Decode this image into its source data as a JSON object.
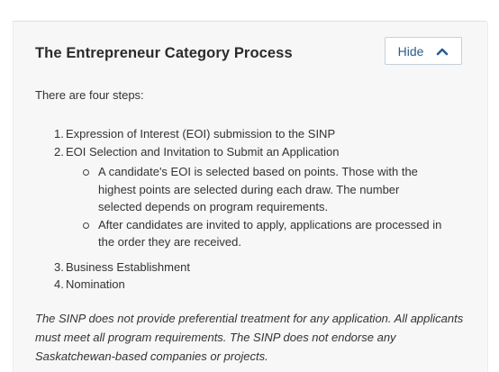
{
  "section": {
    "title": "The Entrepreneur Category Process",
    "toggle_label": "Hide",
    "intro": "There are four steps:",
    "steps": [
      {
        "number": "1.",
        "text": "Expression of Interest (EOI) submission to the SINP"
      },
      {
        "number": "2.",
        "text": "EOI Selection and Invitation to Submit an Application",
        "sub_items": [
          "A candidate's EOI is selected based on points. Those with the highest points are selected during each draw. The number selected depends on program requirements.",
          "After candidates are invited to apply, applications are processed in the order they are received."
        ]
      },
      {
        "number": "3.",
        "text": "Business Establishment"
      },
      {
        "number": "4.",
        "text": "Nomination"
      }
    ],
    "note": "The SINP does not provide preferential treatment for any application. All applicants must meet all program requirements. The SINP does not endorse any Saskatchewan-based companies or projects."
  },
  "icons": {
    "toggle": "chevron-up-icon"
  },
  "colors": {
    "link": "#2a5d8a",
    "panel_bg": "#f7f7f7",
    "border": "#c9d0d6"
  }
}
